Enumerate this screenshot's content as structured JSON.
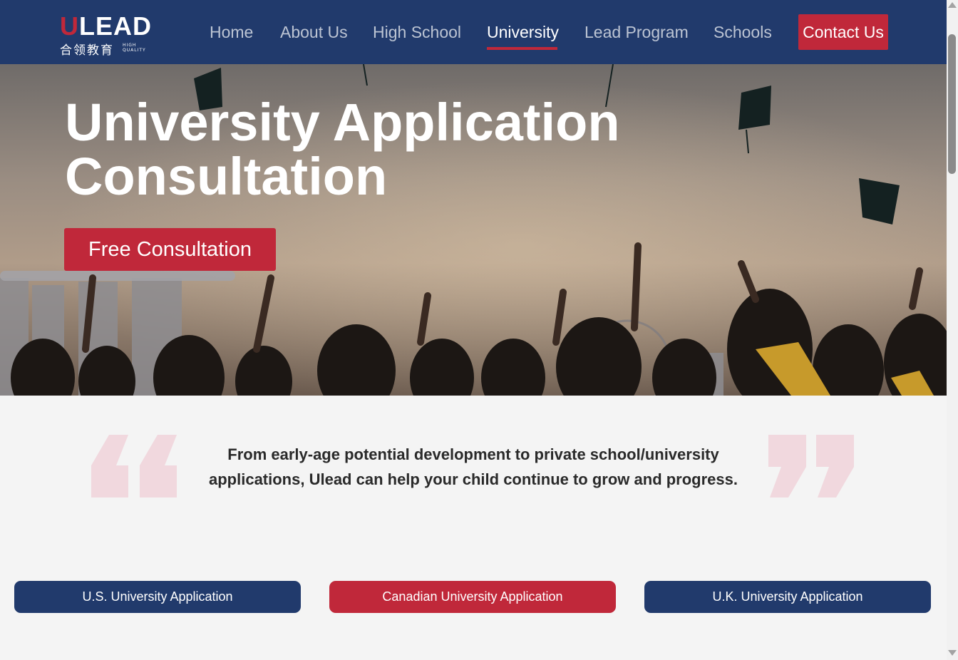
{
  "brand": {
    "logo_text": "ULEAD",
    "logo_text_rest": "LEAD",
    "logo_letter_u": "U",
    "logo_chinese": "合领教育",
    "logo_tagline_1": "HIGH",
    "logo_tagline_2": "QUALITY",
    "primary_color": "#213a6c",
    "accent_color": "#c0283a"
  },
  "nav": {
    "items": [
      {
        "label": "Home"
      },
      {
        "label": "About Us"
      },
      {
        "label": "High School"
      },
      {
        "label": "University"
      },
      {
        "label": "Lead Program"
      },
      {
        "label": "Schools"
      }
    ],
    "active": "University",
    "contact_label": "Contact Us"
  },
  "hero": {
    "title_line1": "University Application",
    "title_line2": "Consultation",
    "cta_label": "Free Consultation"
  },
  "quote": {
    "text": "From early-age potential development to private school/university applications, Ulead can help your child continue to grow and progress."
  },
  "applications": [
    {
      "label": "U.S. University Application",
      "color": "#213a6c"
    },
    {
      "label": "Canadian University Application",
      "color": "#c0283a"
    },
    {
      "label": "U.K. University Application",
      "color": "#213a6c"
    }
  ]
}
